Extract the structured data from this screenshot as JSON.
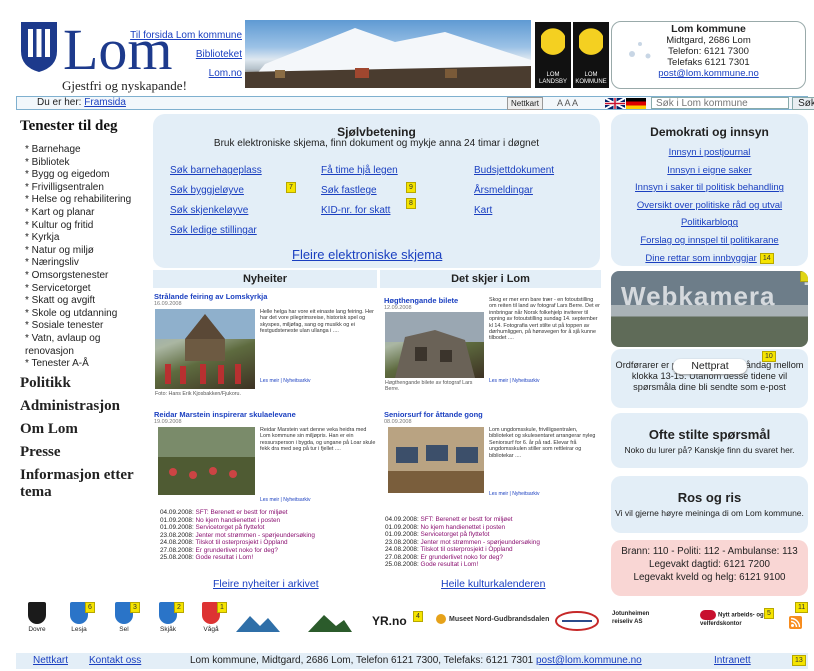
{
  "header": {
    "logo_name": "Lom",
    "slogan": "Gjestfri og nyskapande!",
    "links": [
      "Til forsida Lom kommune",
      "Biblioteket",
      "Lom.no"
    ],
    "emblems": [
      {
        "label": "LOM LANDSBY"
      },
      {
        "label": "LOM KOMMUNE"
      }
    ],
    "contact": {
      "name": "Lom kommune",
      "address": "Midtgard, 2686 Lom",
      "phone": "Telefon: 6121 7300",
      "fax": "Telefaks 6121 7301",
      "email": "post@lom.kommune.no"
    }
  },
  "bar": {
    "you_are_here": "Du er her:",
    "breadcrumb": "Framsida",
    "nettkart": "Nettkart",
    "text_size": "A A A",
    "search_placeholder": "Søk i Lom kommune",
    "search_button": "Søk"
  },
  "nav": {
    "title": "Tenester til deg",
    "items": [
      "Barnehage",
      "Bibliotek",
      "Bygg og eigedom",
      "Frivilligsentralen",
      "Helse og rehabilitering",
      "Kart og planar",
      "Kultur og fritid",
      "Kyrkja",
      "Natur og miljø",
      "Næringsliv",
      "Omsorgstenester",
      "Servicetorget",
      "Skatt og avgift",
      "Skole og utdanning",
      "Sosiale tenester",
      "Vatn, avlaup og renovasjon",
      "Tenester A-Å"
    ],
    "sections": [
      "Politikk",
      "Administrasjon",
      "Om Lom",
      "Presse",
      "Informasjon etter tema"
    ]
  },
  "self": {
    "title": "Sjølvbetening",
    "subtitle": "Bruk elektroniske skjema, finn dokument og mykje anna 24 timar i døgnet",
    "col1": [
      "Søk barnehageplass",
      "Søk byggjeløyve",
      "Søk skjenkeløyve",
      "Søk ledige stillingar"
    ],
    "col2": [
      "Få time hjå legen",
      "Søk fastlege",
      "KID-nr. for skatt"
    ],
    "col3": [
      "Budsjettdokument",
      "Årsmeldingar",
      "Kart"
    ],
    "badges": [
      "7",
      "9",
      "8"
    ],
    "more": "Fleire elektroniske skjema"
  },
  "demo": {
    "title": "Demokrati og innsyn",
    "links": [
      "Innsyn i postjournal",
      "Innsyn i eigne saker",
      "Innsyn i saker til politisk behandling",
      "Oversikt over politiske råd og utval",
      "Politikarblogg",
      "Forslag og innspel til politikarane",
      "Dine rettar som innbyggjar"
    ],
    "badge": "14"
  },
  "news": {
    "heading": "Nyheiter",
    "a1": {
      "title": "Strålande feiring av Lomskyrkja",
      "date": "16.09.2008",
      "text": "Helle helga har vore eit einaste lang feiring. Her har det vore pilegrimsreise, historisk spel og skyspes, miljøfag, sang og musikk og ei festgudsteneste ulan ullanga i ....",
      "caption": "Foto: Hans Erik Kjosbakken/Fjukoru.",
      "read": "Les meir | Nyheitsarkiv"
    },
    "a2": {
      "title": "Reidar Marstein inspirerar skulaelevane",
      "date": "19.09.2008",
      "text": "Reidar Marstein vart denne veka heidra med Lom kommune sin miljøpris. Han er ein ressursperson i bygda, og ungane på Loar skule fekk dra med seg på tur i fjellet ....",
      "read": "Les meir | Nyheitsarkiv"
    },
    "list": [
      {
        "d": "04.09.2008:",
        "t": "SFT: Berenett er bestt for miljøet"
      },
      {
        "d": "01.09.2008:",
        "t": "No kjem handienettet i posten"
      },
      {
        "d": "01.09.2008:",
        "t": "Servicetorget på flyttefot"
      },
      {
        "d": "23.08.2008:",
        "t": "Jenter mot strømmen - spørjeundersøking"
      },
      {
        "d": "24.08.2008:",
        "t": "Tilskot til osterprosjekt i Oppland"
      },
      {
        "d": "27.08.2008:",
        "t": "Er grunderlivet noko for deg?"
      },
      {
        "d": "25.08.2008:",
        "t": "Gode resultat i Lom!"
      }
    ],
    "more": "Fleire nyheiter i arkivet"
  },
  "events": {
    "heading": "Det skjer i Lom",
    "a1": {
      "title": "Høgthengande bilete",
      "date": "12.09.2008",
      "text": "Skog er mer enn bare trær - en fotoutstilling om reiten til land av fotograf Lars Berre. Det er innbringar når Norsk folkehjelp inviterer til opning av fotoutstilling sundag 14. september kl 14. Fotografia vert stilte ut på toppen av dørhumliggen, på hønsvegen for å sjå kunne tilbodet ....",
      "caption": "Høgthengande bilete av fotograf Lars Berre.",
      "read": "Les meir | Nyheitsarkiv"
    },
    "a2": {
      "title": "Seniorsurf for åttande gong",
      "date": "08.09.2008",
      "text": "Lom ungdomsskule, frivilligsentralen, biblioteket og skulesentaret arrangerar nyleg Seniorsurf for 6. år på rad. Elevar frå ungdomsskulen stiller som rettleirar og bibliotekar ....",
      "read": "Les meir | Nyheitsarkiv"
    },
    "list": [
      {
        "d": "04.09.2008:",
        "t": "SFT: Berenett er bestt for miljøet"
      },
      {
        "d": "01.09.2008:",
        "t": "No kjem handienettet i posten"
      },
      {
        "d": "01.09.2008:",
        "t": "Servicetorget på flyttefot"
      },
      {
        "d": "23.08.2008:",
        "t": "Jenter mot strømmen - spørjeundersøking"
      },
      {
        "d": "24.08.2008:",
        "t": "Tilskot til osterprosjekt i Oppland"
      },
      {
        "d": "27.08.2008:",
        "t": "Er grunderlivet noko for deg?"
      },
      {
        "d": "25.08.2008:",
        "t": "Gode resultat i Lom!"
      }
    ],
    "more": "Heile kulturkalenderen"
  },
  "right": {
    "webcam": "Webkamera",
    "webcam_badge": "12",
    "prat_button": "Nettprat",
    "prat_badge": "10",
    "prat_text": "Ordførarer er på nettprat kvar måndag mellom klokka 13-15. Utanom desse tidene vil spørsmåla dine bli sendte som e-post",
    "faq_title": "Ofte stilte spørsmål",
    "faq_sub": "Noko du lurer på? Kanskje finn du svaret her.",
    "ros_title": "Ros og ris",
    "ros_sub": "Vi vil gjerne høyre meininga di om Lom kommune.",
    "emergency": [
      "Brann: 110 - Politi: 112 - Ambulanse: 113",
      "Legevakt dagtid: 6121 7200",
      "Legevakt kveld og helg: 6121 9100"
    ]
  },
  "partners": {
    "crests": [
      {
        "name": "Dovre",
        "badge": "",
        "color": "#1b1b1b"
      },
      {
        "name": "Lesja",
        "badge": "6",
        "color": "#2a74c8"
      },
      {
        "name": "Sel",
        "badge": "3",
        "color": "#2a74c8"
      },
      {
        "name": "Skjåk",
        "badge": "2",
        "color": "#2a74c8"
      },
      {
        "name": "Vågå",
        "badge": "1",
        "color": "#d33"
      }
    ],
    "logos": [
      "",
      "",
      "YR.no",
      "Museet Nord-Gudbrandsdalen",
      "",
      "Jotunheimen reiseliv AS",
      "Nytt arbeids- og velferdskontor"
    ],
    "logo_badges": [
      "4",
      "5",
      "11"
    ]
  },
  "footer": {
    "links": [
      "Nettkart",
      "Kontakt oss"
    ],
    "text": "Lom kommune, Midtgard, 2686 Lom, Telefon 6121 7300, Telefaks: 6121 7301",
    "email": "post@lom.kommune.no",
    "intranet": "Intranett",
    "badge": "13"
  }
}
